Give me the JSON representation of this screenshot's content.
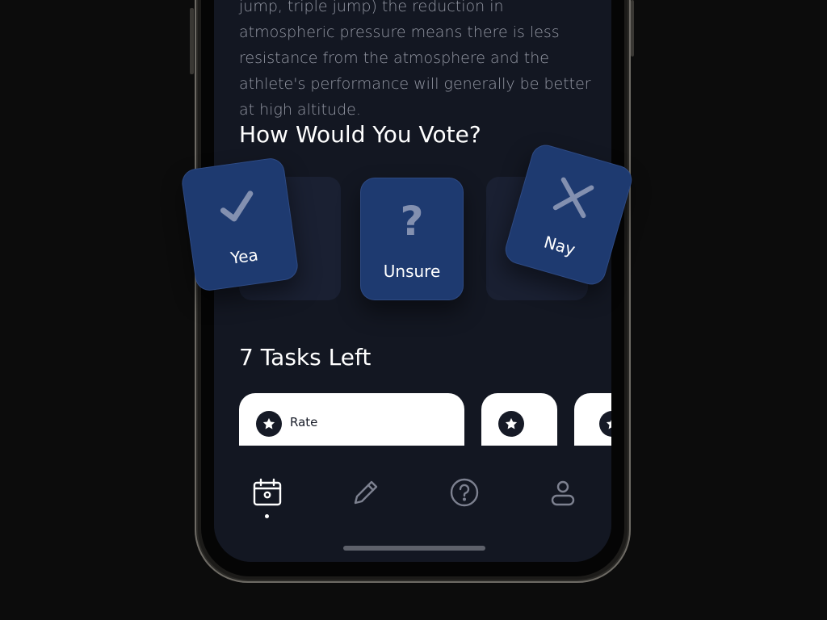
{
  "article": {
    "body": "jump, triple jump) the reduction in atmospheric pressure means there is less resistance from the atmosphere and the athlete's performance will generally be better at high altitude."
  },
  "vote": {
    "title": "How Would You Vote?",
    "options": [
      {
        "label": "Yea",
        "icon": "check-icon"
      },
      {
        "label": "Unsure",
        "icon": "question-mark-icon",
        "glyph": "?"
      },
      {
        "label": "Nay",
        "icon": "x-icon"
      }
    ]
  },
  "tasks": {
    "title": "7 Tasks Left",
    "items": [
      {
        "label": "Rate",
        "icon": "star-icon"
      },
      {
        "label": "",
        "icon": "star-icon"
      },
      {
        "label": "",
        "icon": "star-icon"
      }
    ]
  },
  "tabbar": {
    "items": [
      {
        "name": "calendar",
        "icon": "calendar-icon",
        "active": true
      },
      {
        "name": "edit",
        "icon": "pencil-icon",
        "active": false
      },
      {
        "name": "help",
        "icon": "question-circle-icon",
        "active": false
      },
      {
        "name": "profile",
        "icon": "user-icon",
        "active": false
      }
    ]
  },
  "colors": {
    "background": "#0c0c0c",
    "screen": "#131722",
    "card": "#1e3a70",
    "icon_muted": "#8390b0",
    "text_muted": "#9498a4"
  }
}
